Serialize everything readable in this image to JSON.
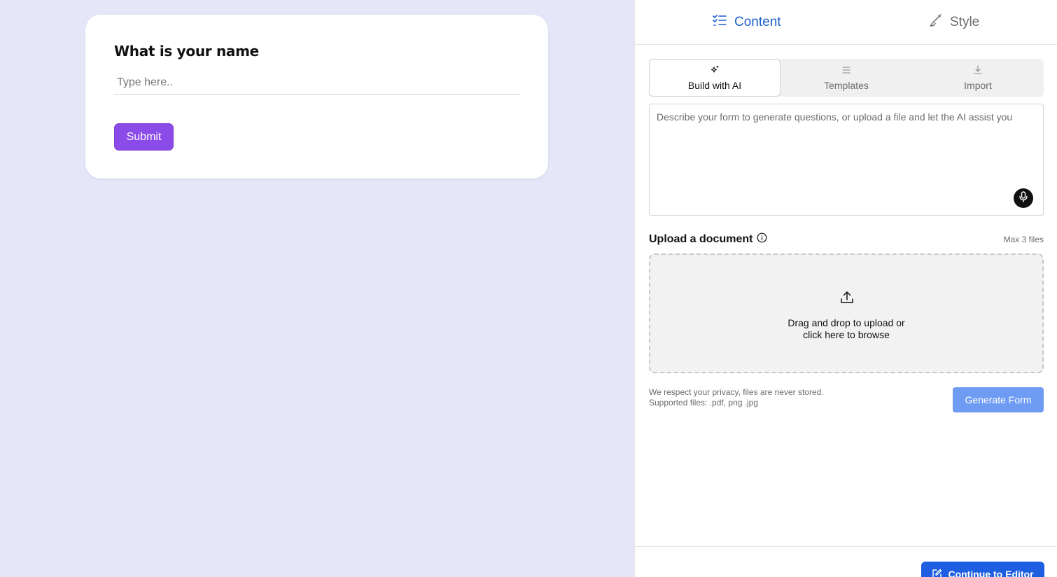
{
  "preview": {
    "question": "What is your name",
    "input_placeholder": "Type here..",
    "submit_label": "Submit"
  },
  "editor": {
    "tabs": [
      {
        "label": "Content",
        "icon": "list-check-icon",
        "active": true
      },
      {
        "label": "Style",
        "icon": "brush-icon",
        "active": false
      }
    ],
    "modes": [
      {
        "label": "Build with AI",
        "icon": "sparkle-icon",
        "active": true
      },
      {
        "label": "Templates",
        "icon": "menu-lines-icon",
        "active": false
      },
      {
        "label": "Import",
        "icon": "download-icon",
        "active": false
      }
    ],
    "prompt_placeholder": "Describe your form to generate questions, or upload a file and let the AI assist you",
    "upload": {
      "title": "Upload a document",
      "max_files": "Max 3 files",
      "drop_line1": "Drag and drop to upload or",
      "drop_line2": "click here to browse"
    },
    "privacy_line1": "We respect your privacy, files are never stored.",
    "privacy_line2": "Supported files: .pdf, png .jpg",
    "generate_label": "Generate Form",
    "continue_label": "Continue to Editor"
  },
  "colors": {
    "preview_bg": "#e5e6f8",
    "submit": "#8b4be8",
    "accent_blue": "#1d5fe0",
    "generate_disabled": "#6f9cf3"
  }
}
